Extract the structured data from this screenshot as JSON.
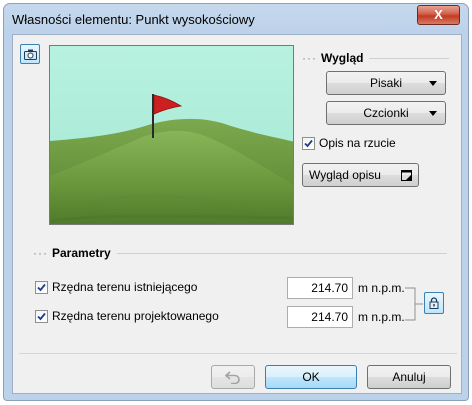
{
  "window": {
    "title": "Własności elementu: Punkt wysokościowy",
    "close_label": "X"
  },
  "appearance": {
    "heading": "Wygląd",
    "pens_label": "Pisaki",
    "fonts_label": "Czcionki",
    "show_on_plan_label": "Opis na rzucie",
    "show_on_plan_checked": true,
    "label_style_label": "Wygląd opisu"
  },
  "params": {
    "heading": "Parametry",
    "rows": [
      {
        "label": "Rzędna terenu istniejącego",
        "value": "214.70",
        "unit": "m n.p.m.",
        "checked": true
      },
      {
        "label": "Rzędna terenu projektowanego",
        "value": "214.70",
        "unit": "m n.p.m.",
        "checked": true
      }
    ]
  },
  "buttons": {
    "ok": "OK",
    "cancel": "Anuluj"
  },
  "icons": {
    "camera": "camera-icon",
    "lock": "lock-icon",
    "undo": "undo-icon",
    "popup": "popup-window-icon"
  },
  "colors": {
    "accent": "#3c7fb1",
    "close": "#c13a23",
    "flag": "#cc1f1f"
  }
}
